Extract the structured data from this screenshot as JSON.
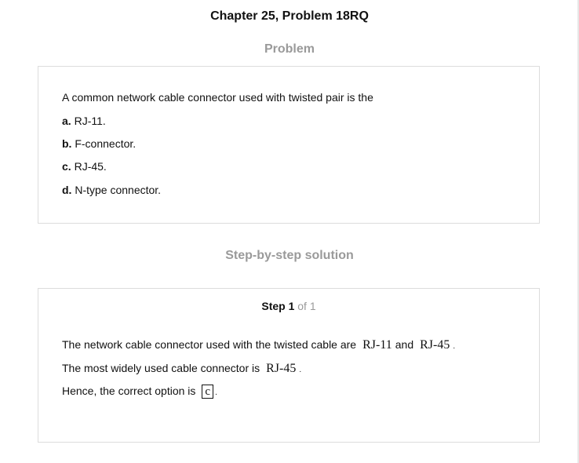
{
  "page": {
    "title": "Chapter 25, Problem 18RQ"
  },
  "problem": {
    "heading": "Problem",
    "question": "A common network cable connector used with twisted pair is the",
    "options": [
      {
        "letter": "a.",
        "text": "RJ-11."
      },
      {
        "letter": "b.",
        "text": "F-connector."
      },
      {
        "letter": "c.",
        "text": "RJ-45."
      },
      {
        "letter": "d.",
        "text": "N-type connector."
      }
    ]
  },
  "solution": {
    "heading": "Step-by-step solution",
    "step_label": "Step 1",
    "step_of": "of 1",
    "line1": {
      "text": "The network cable connector used with the twisted cable are",
      "term1": "RJ-11",
      "joiner": "and",
      "term2": "RJ-45",
      "end": "."
    },
    "line2": {
      "text": "The most widely used cable connector is",
      "term": "RJ-45",
      "end": "."
    },
    "line3": {
      "text": "Hence, the correct option is",
      "answer": "c",
      "end": "."
    }
  }
}
